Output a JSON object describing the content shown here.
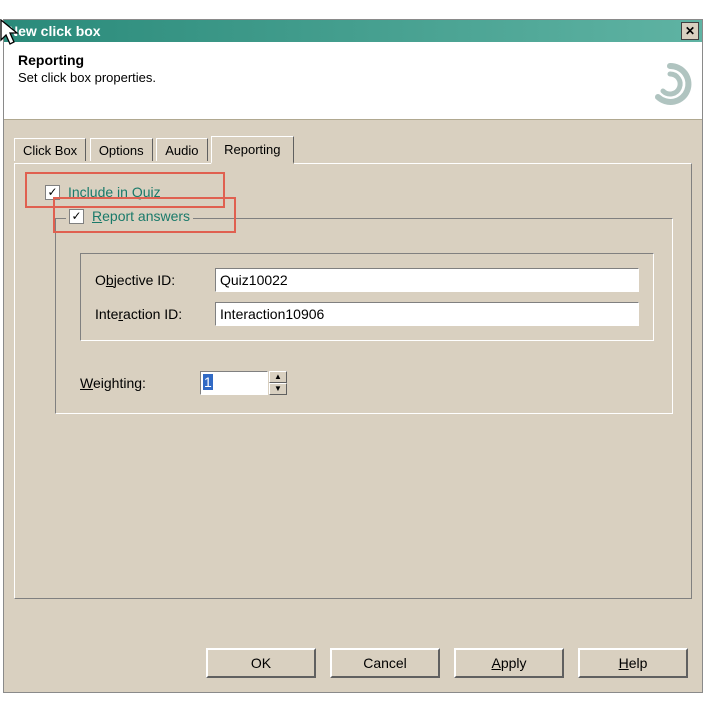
{
  "titlebar": {
    "text": "New click box"
  },
  "header": {
    "title": "Reporting",
    "subtitle": "Set click box properties."
  },
  "tabs": {
    "click_box": "Click Box",
    "options": "Options",
    "audio": "Audio",
    "reporting": "Reporting"
  },
  "reporting": {
    "include_in_quiz_label": "Include in Quiz",
    "include_in_quiz_underline": "I",
    "include_in_quiz_rest": "nclude in Quiz",
    "report_answers_label": "Report answers",
    "report_answers_underline": "R",
    "report_answers_rest": "eport answers",
    "objective_id_label_pre": "O",
    "objective_id_label_u": "b",
    "objective_id_label_post": "jective ID:",
    "objective_id_value": "Quiz10022",
    "interaction_id_label_pre": "Inte",
    "interaction_id_label_u": "r",
    "interaction_id_label_post": "action ID:",
    "interaction_id_value": "Interaction10906",
    "weighting_label_u": "W",
    "weighting_label_rest": "eighting:",
    "weighting_value": "1"
  },
  "buttons": {
    "ok": "OK",
    "cancel": "Cancel",
    "apply_u": "A",
    "apply_rest": "pply",
    "help_u": "H",
    "help_rest": "elp"
  }
}
